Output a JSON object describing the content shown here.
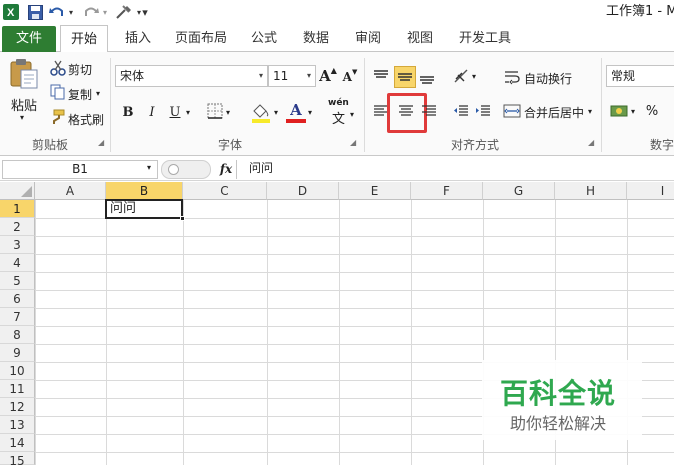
{
  "titlebar": {
    "title": "工作簿1 - M",
    "menu_caret": "▾"
  },
  "tabs": [
    "文件",
    "开始",
    "插入",
    "页面布局",
    "公式",
    "数据",
    "审阅",
    "视图",
    "开发工具"
  ],
  "ribbon": {
    "clipboard": {
      "paste": "粘贴",
      "cut": "剪切",
      "copy": "复制",
      "format_painter": "格式刷",
      "group": "剪贴板"
    },
    "font": {
      "name": "宋体",
      "size": "11",
      "bold": "B",
      "italic": "I",
      "underline": "U",
      "grow": "A",
      "shrink": "A",
      "font_color_letter": "A",
      "wen": "wén",
      "wen_char": "文",
      "group": "字体"
    },
    "alignment": {
      "wrap_text": "自动换行",
      "merge_center": "合并后居中",
      "group": "对齐方式"
    },
    "number": {
      "format": "常规",
      "percent": "%",
      "group": "数字"
    },
    "colors": {
      "accent_green": "#2e7d32",
      "selected_button": "#f8d56a",
      "highlight_box": "#e03a3a"
    }
  },
  "formula_bar": {
    "name_box": "B1",
    "fx": "fx",
    "value": "问问"
  },
  "sheet": {
    "columns": [
      "A",
      "B",
      "C",
      "D",
      "E",
      "F",
      "G",
      "H",
      "I"
    ],
    "rows": [
      "1",
      "2",
      "3",
      "4",
      "5",
      "6",
      "7",
      "8",
      "9",
      "10",
      "11",
      "12",
      "13",
      "14",
      "15"
    ],
    "cell_B1": "问问",
    "active_column": "B",
    "active_row": "1"
  },
  "watermark": {
    "brand": "百科全说",
    "slogan": "助你轻松解决"
  }
}
